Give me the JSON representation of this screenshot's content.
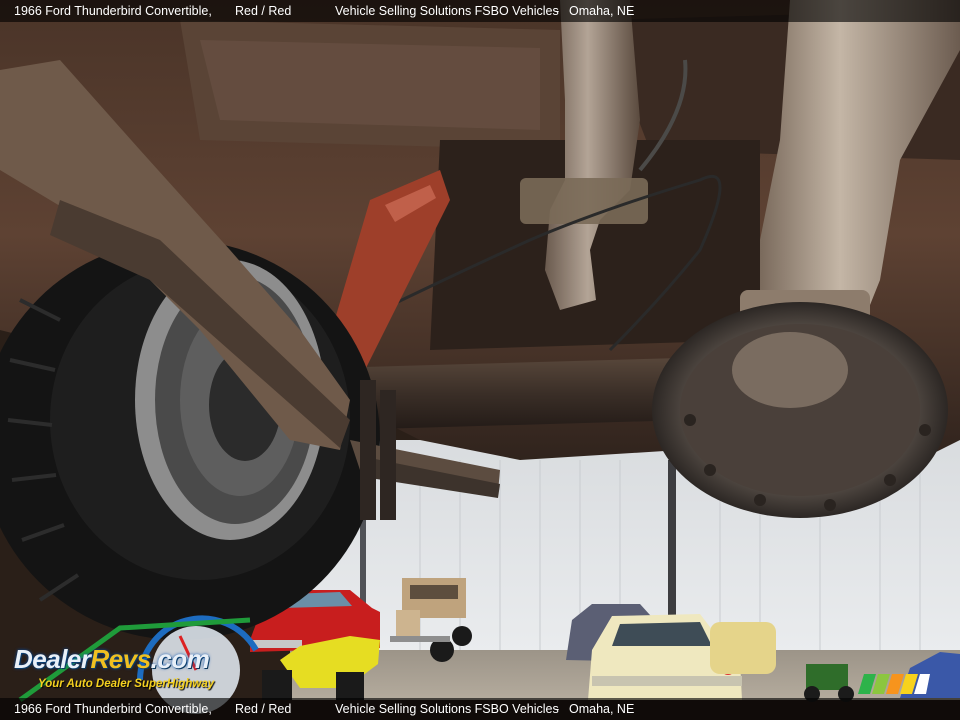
{
  "caption": {
    "vehicle": "1966 Ford Thunderbird Convertible,",
    "colors": "Red / Red",
    "seller": "Vehicle Selling Solutions FSBO Vehicles",
    "separator": "-",
    "location": "Omaha, NE"
  },
  "watermark": {
    "brand_prefix": "Dealer",
    "brand_accent": "Revs",
    "brand_suffix": ".com",
    "tagline": "Your Auto Dealer SuperHighway"
  },
  "colors": {
    "caption_bg": "#000000",
    "caption_text": "#ffffff",
    "tagline": "#f4d020",
    "wall": "#e6e8eb",
    "rust": "#6e4a35",
    "tire": "#151515",
    "red_car": "#d02020",
    "cream_car": "#efe8bf"
  },
  "icons": [
    "speedometer-icon",
    "stripe-logo-icon"
  ]
}
